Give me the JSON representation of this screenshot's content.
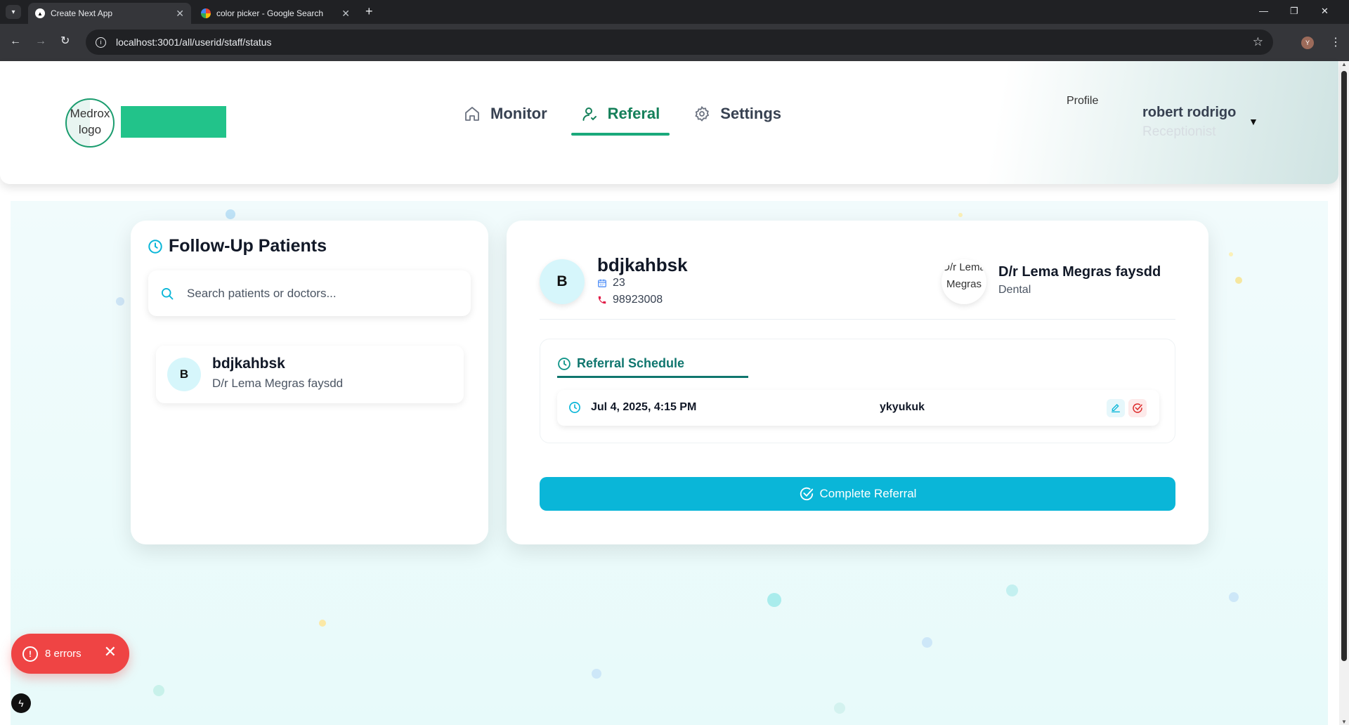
{
  "browser": {
    "tabs": [
      {
        "title": "Create Next App",
        "active": true
      },
      {
        "title": "color picker - Google Search",
        "active": false
      }
    ],
    "url": "localhost:3001/all/userid/staff/status",
    "profile_initial": "Y"
  },
  "header": {
    "logo_alt": "Medrox logo",
    "nav": [
      {
        "label": "Monitor",
        "icon": "home-icon"
      },
      {
        "label": "Referal",
        "icon": "user-icon"
      },
      {
        "label": "Settings",
        "icon": "gear-icon"
      }
    ],
    "active_nav": "Referal",
    "profile_alt": "Profile",
    "user_name": "robert rodrigo",
    "user_role": "Receptionist"
  },
  "followup": {
    "title": "Follow-Up Patients",
    "search_placeholder": "Search patients or doctors...",
    "patients": [
      {
        "initial": "B",
        "name": "bdjkahbsk",
        "doctor": "D/r Lema Megras faysdd"
      }
    ]
  },
  "detail": {
    "patient_initial": "B",
    "patient_name": "bdjkahbsk",
    "age": "23",
    "phone": "98923008",
    "doctor_alt": "D/r Lema Megras",
    "doctor_name": "D/r Lema Megras faysdd",
    "doctor_specialty": "Dental",
    "schedule_title": "Referral Schedule",
    "schedule": [
      {
        "datetime": "Jul 4, 2025, 4:15 PM",
        "note": "ykyukuk"
      }
    ],
    "complete_label": "Complete Referral"
  },
  "dev": {
    "errors_label": "8 errors"
  },
  "colors": {
    "brand_green": "#15805a",
    "accent_cyan": "#0ab6d8",
    "error_red": "#ef4444"
  }
}
